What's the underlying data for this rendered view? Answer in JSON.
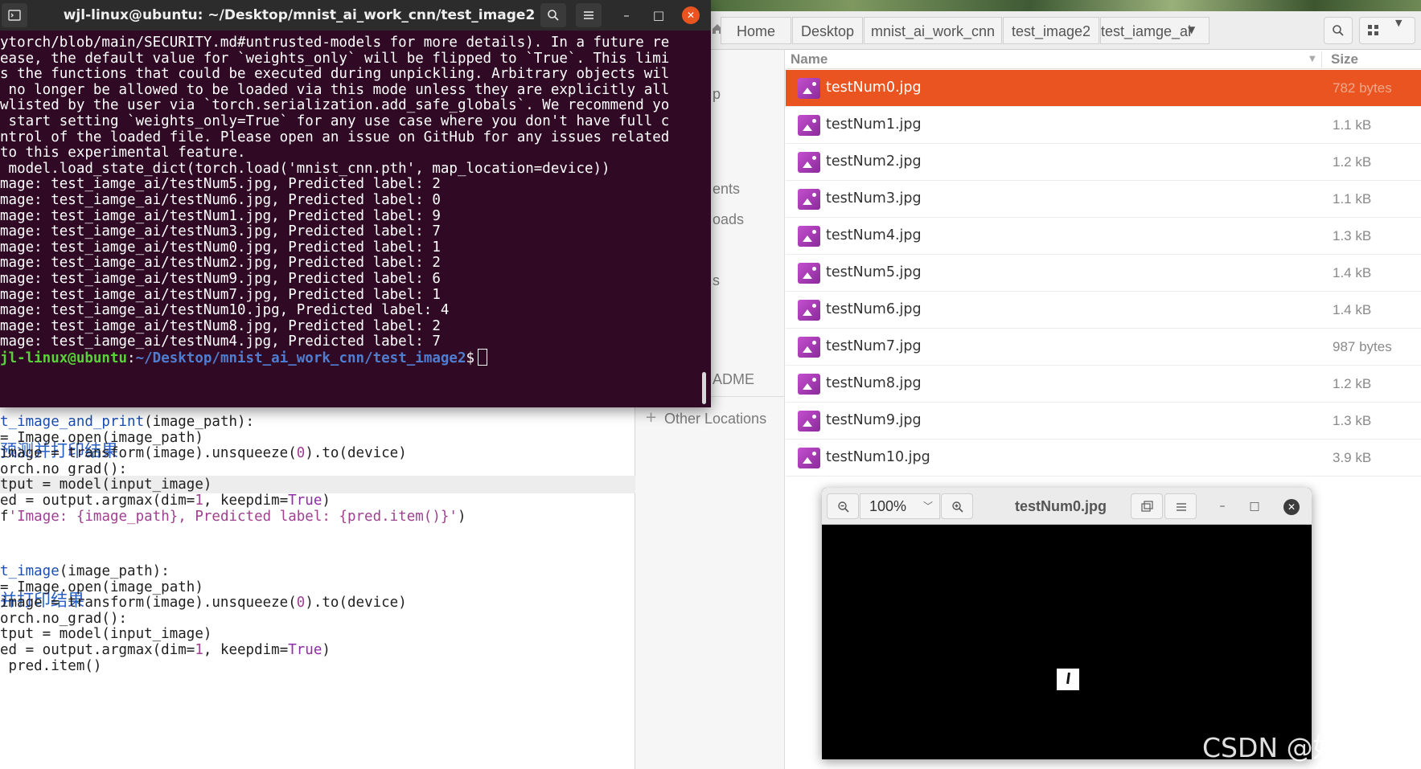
{
  "terminal": {
    "title": "wjl-linux@ubuntu: ~/Desktop/mnist_ai_work_cnn/test_image2",
    "lines": [
      "ytorch/blob/main/SECURITY.md#untrusted-models for more details). In a future re",
      "ease, the default value for `weights_only` will be flipped to `True`. This limi",
      "s the functions that could be executed during unpickling. Arbitrary objects wil",
      " no longer be allowed to be loaded via this mode unless they are explicitly all",
      "wlisted by the user via `torch.serialization.add_safe_globals`. We recommend yo",
      " start setting `weights_only=True` for any use case where you don't have full c",
      "ntrol of the loaded file. Please open an issue on GitHub for any issues related",
      "to this experimental feature.",
      " model.load_state_dict(torch.load('mnist_cnn.pth', map_location=device))",
      "mage: test_iamge_ai/testNum5.jpg, Predicted label: 2",
      "mage: test_iamge_ai/testNum6.jpg, Predicted label: 0",
      "mage: test_iamge_ai/testNum1.jpg, Predicted label: 9",
      "mage: test_iamge_ai/testNum3.jpg, Predicted label: 7",
      "mage: test_iamge_ai/testNum0.jpg, Predicted label: 1",
      "mage: test_iamge_ai/testNum2.jpg, Predicted label: 2",
      "mage: test_iamge_ai/testNum9.jpg, Predicted label: 6",
      "mage: test_iamge_ai/testNum7.jpg, Predicted label: 1",
      "mage: test_iamge_ai/testNum10.jpg, Predicted label: 4",
      "mage: test_iamge_ai/testNum8.jpg, Predicted label: 2",
      "mage: test_iamge_ai/testNum4.jpg, Predicted label: 7"
    ],
    "prompt_user": "jl-linux@ubuntu",
    "prompt_sep": ":",
    "prompt_path": "~/Desktop/mnist_ai_work_cnn/test_image2",
    "prompt_symbol": "$"
  },
  "editor": {
    "comment1": "预测并打印结果",
    "comment2": "并打印结果",
    "block1": [
      [
        "t_image_and_print",
        "(image_path):"
      ],
      [
        "= Image.open(image_path)"
      ],
      [
        "image = transform(image).unsqueeze(",
        "0",
        ").to(device)"
      ],
      [
        "orch.no_grad():"
      ],
      [
        "tput = model(input_image)"
      ],
      [
        "ed = output.argmax(dim=",
        "1",
        ", keepdim=",
        "True",
        ")"
      ],
      [
        "f",
        "'Image: {image_path}, Predicted label: {pred.item()}'",
        ")"
      ]
    ],
    "block2": [
      [
        "t_image",
        "(image_path):"
      ],
      [
        "= Image.open(image_path)"
      ],
      [
        "image = transform(image).unsqueeze(",
        "0",
        ").to(device)"
      ],
      [
        "orch.no_grad():"
      ],
      [
        "tput = model(input_image)"
      ],
      [
        "ed = output.argmax(dim=",
        "1",
        ", keepdim=",
        "True",
        ")"
      ],
      [
        " pred.item()"
      ]
    ]
  },
  "files": {
    "breadcrumbs": [
      "Home",
      "Desktop",
      "mnist_ai_work_cnn",
      "test_image2",
      "test_iamge_ai"
    ],
    "sidebar_fragments": [
      "p",
      "ents",
      "oads",
      "s",
      "ADME"
    ],
    "other_locations": "Other Locations",
    "columns": {
      "name": "Name",
      "size": "Size"
    },
    "rows": [
      {
        "name": "testNum0.jpg",
        "size": "782 bytes",
        "selected": true
      },
      {
        "name": "testNum1.jpg",
        "size": "1.1 kB"
      },
      {
        "name": "testNum2.jpg",
        "size": "1.2 kB"
      },
      {
        "name": "testNum3.jpg",
        "size": "1.1 kB"
      },
      {
        "name": "testNum4.jpg",
        "size": "1.3 kB"
      },
      {
        "name": "testNum5.jpg",
        "size": "1.4 kB"
      },
      {
        "name": "testNum6.jpg",
        "size": "1.4 kB"
      },
      {
        "name": "testNum7.jpg",
        "size": "987 bytes"
      },
      {
        "name": "testNum8.jpg",
        "size": "1.2 kB"
      },
      {
        "name": "testNum9.jpg",
        "size": "1.3 kB"
      },
      {
        "name": "testNum10.jpg",
        "size": "3.9 kB"
      }
    ]
  },
  "viewer": {
    "zoom": "100%",
    "title": "testNum0.jpg"
  },
  "watermark": "CSDN @好奇龙猫",
  "colors": {
    "terminal_bg": "#300a24",
    "selection": "#e95420",
    "prompt_user": "#5ad13a",
    "prompt_path": "#4f7dd0"
  },
  "icons": [
    "terminal-icon",
    "search-icon",
    "menu-icon",
    "minimize-icon",
    "maximize-icon",
    "close-icon",
    "home-icon",
    "grid-view-icon",
    "chevron-down-icon",
    "image-file-icon",
    "zoom-out-icon",
    "zoom-in-icon",
    "gallery-icon",
    "plus-icon"
  ]
}
